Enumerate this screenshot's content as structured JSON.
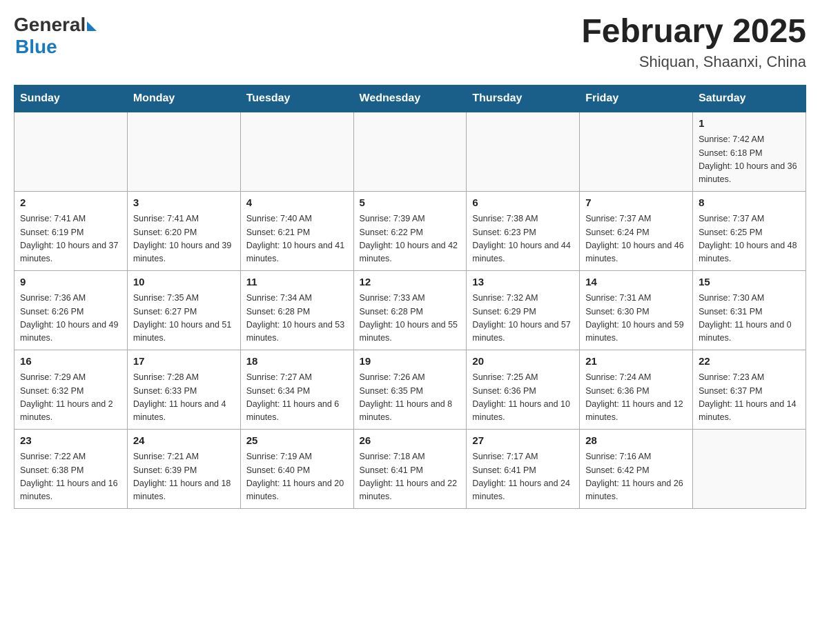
{
  "header": {
    "logo_general": "General",
    "logo_blue": "Blue",
    "title": "February 2025",
    "location": "Shiquan, Shaanxi, China"
  },
  "days_of_week": [
    "Sunday",
    "Monday",
    "Tuesday",
    "Wednesday",
    "Thursday",
    "Friday",
    "Saturday"
  ],
  "weeks": [
    [
      {
        "day": "",
        "info": ""
      },
      {
        "day": "",
        "info": ""
      },
      {
        "day": "",
        "info": ""
      },
      {
        "day": "",
        "info": ""
      },
      {
        "day": "",
        "info": ""
      },
      {
        "day": "",
        "info": ""
      },
      {
        "day": "1",
        "info": "Sunrise: 7:42 AM\nSunset: 6:18 PM\nDaylight: 10 hours and 36 minutes."
      }
    ],
    [
      {
        "day": "2",
        "info": "Sunrise: 7:41 AM\nSunset: 6:19 PM\nDaylight: 10 hours and 37 minutes."
      },
      {
        "day": "3",
        "info": "Sunrise: 7:41 AM\nSunset: 6:20 PM\nDaylight: 10 hours and 39 minutes."
      },
      {
        "day": "4",
        "info": "Sunrise: 7:40 AM\nSunset: 6:21 PM\nDaylight: 10 hours and 41 minutes."
      },
      {
        "day": "5",
        "info": "Sunrise: 7:39 AM\nSunset: 6:22 PM\nDaylight: 10 hours and 42 minutes."
      },
      {
        "day": "6",
        "info": "Sunrise: 7:38 AM\nSunset: 6:23 PM\nDaylight: 10 hours and 44 minutes."
      },
      {
        "day": "7",
        "info": "Sunrise: 7:37 AM\nSunset: 6:24 PM\nDaylight: 10 hours and 46 minutes."
      },
      {
        "day": "8",
        "info": "Sunrise: 7:37 AM\nSunset: 6:25 PM\nDaylight: 10 hours and 48 minutes."
      }
    ],
    [
      {
        "day": "9",
        "info": "Sunrise: 7:36 AM\nSunset: 6:26 PM\nDaylight: 10 hours and 49 minutes."
      },
      {
        "day": "10",
        "info": "Sunrise: 7:35 AM\nSunset: 6:27 PM\nDaylight: 10 hours and 51 minutes."
      },
      {
        "day": "11",
        "info": "Sunrise: 7:34 AM\nSunset: 6:28 PM\nDaylight: 10 hours and 53 minutes."
      },
      {
        "day": "12",
        "info": "Sunrise: 7:33 AM\nSunset: 6:28 PM\nDaylight: 10 hours and 55 minutes."
      },
      {
        "day": "13",
        "info": "Sunrise: 7:32 AM\nSunset: 6:29 PM\nDaylight: 10 hours and 57 minutes."
      },
      {
        "day": "14",
        "info": "Sunrise: 7:31 AM\nSunset: 6:30 PM\nDaylight: 10 hours and 59 minutes."
      },
      {
        "day": "15",
        "info": "Sunrise: 7:30 AM\nSunset: 6:31 PM\nDaylight: 11 hours and 0 minutes."
      }
    ],
    [
      {
        "day": "16",
        "info": "Sunrise: 7:29 AM\nSunset: 6:32 PM\nDaylight: 11 hours and 2 minutes."
      },
      {
        "day": "17",
        "info": "Sunrise: 7:28 AM\nSunset: 6:33 PM\nDaylight: 11 hours and 4 minutes."
      },
      {
        "day": "18",
        "info": "Sunrise: 7:27 AM\nSunset: 6:34 PM\nDaylight: 11 hours and 6 minutes."
      },
      {
        "day": "19",
        "info": "Sunrise: 7:26 AM\nSunset: 6:35 PM\nDaylight: 11 hours and 8 minutes."
      },
      {
        "day": "20",
        "info": "Sunrise: 7:25 AM\nSunset: 6:36 PM\nDaylight: 11 hours and 10 minutes."
      },
      {
        "day": "21",
        "info": "Sunrise: 7:24 AM\nSunset: 6:36 PM\nDaylight: 11 hours and 12 minutes."
      },
      {
        "day": "22",
        "info": "Sunrise: 7:23 AM\nSunset: 6:37 PM\nDaylight: 11 hours and 14 minutes."
      }
    ],
    [
      {
        "day": "23",
        "info": "Sunrise: 7:22 AM\nSunset: 6:38 PM\nDaylight: 11 hours and 16 minutes."
      },
      {
        "day": "24",
        "info": "Sunrise: 7:21 AM\nSunset: 6:39 PM\nDaylight: 11 hours and 18 minutes."
      },
      {
        "day": "25",
        "info": "Sunrise: 7:19 AM\nSunset: 6:40 PM\nDaylight: 11 hours and 20 minutes."
      },
      {
        "day": "26",
        "info": "Sunrise: 7:18 AM\nSunset: 6:41 PM\nDaylight: 11 hours and 22 minutes."
      },
      {
        "day": "27",
        "info": "Sunrise: 7:17 AM\nSunset: 6:41 PM\nDaylight: 11 hours and 24 minutes."
      },
      {
        "day": "28",
        "info": "Sunrise: 7:16 AM\nSunset: 6:42 PM\nDaylight: 11 hours and 26 minutes."
      },
      {
        "day": "",
        "info": ""
      }
    ]
  ]
}
